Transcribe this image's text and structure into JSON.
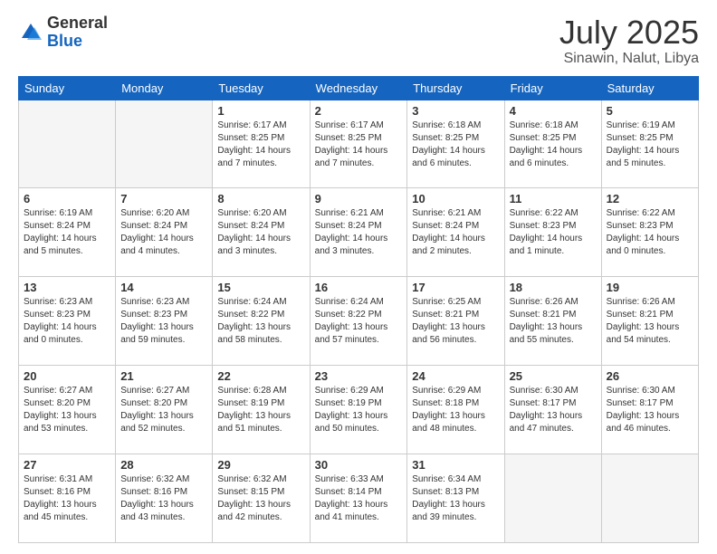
{
  "header": {
    "logo_general": "General",
    "logo_blue": "Blue",
    "month": "July 2025",
    "location": "Sinawin, Nalut, Libya"
  },
  "days_of_week": [
    "Sunday",
    "Monday",
    "Tuesday",
    "Wednesday",
    "Thursday",
    "Friday",
    "Saturday"
  ],
  "weeks": [
    [
      {
        "day": "",
        "info": ""
      },
      {
        "day": "",
        "info": ""
      },
      {
        "day": "1",
        "info": "Sunrise: 6:17 AM\nSunset: 8:25 PM\nDaylight: 14 hours and 7 minutes."
      },
      {
        "day": "2",
        "info": "Sunrise: 6:17 AM\nSunset: 8:25 PM\nDaylight: 14 hours and 7 minutes."
      },
      {
        "day": "3",
        "info": "Sunrise: 6:18 AM\nSunset: 8:25 PM\nDaylight: 14 hours and 6 minutes."
      },
      {
        "day": "4",
        "info": "Sunrise: 6:18 AM\nSunset: 8:25 PM\nDaylight: 14 hours and 6 minutes."
      },
      {
        "day": "5",
        "info": "Sunrise: 6:19 AM\nSunset: 8:25 PM\nDaylight: 14 hours and 5 minutes."
      }
    ],
    [
      {
        "day": "6",
        "info": "Sunrise: 6:19 AM\nSunset: 8:24 PM\nDaylight: 14 hours and 5 minutes."
      },
      {
        "day": "7",
        "info": "Sunrise: 6:20 AM\nSunset: 8:24 PM\nDaylight: 14 hours and 4 minutes."
      },
      {
        "day": "8",
        "info": "Sunrise: 6:20 AM\nSunset: 8:24 PM\nDaylight: 14 hours and 3 minutes."
      },
      {
        "day": "9",
        "info": "Sunrise: 6:21 AM\nSunset: 8:24 PM\nDaylight: 14 hours and 3 minutes."
      },
      {
        "day": "10",
        "info": "Sunrise: 6:21 AM\nSunset: 8:24 PM\nDaylight: 14 hours and 2 minutes."
      },
      {
        "day": "11",
        "info": "Sunrise: 6:22 AM\nSunset: 8:23 PM\nDaylight: 14 hours and 1 minute."
      },
      {
        "day": "12",
        "info": "Sunrise: 6:22 AM\nSunset: 8:23 PM\nDaylight: 14 hours and 0 minutes."
      }
    ],
    [
      {
        "day": "13",
        "info": "Sunrise: 6:23 AM\nSunset: 8:23 PM\nDaylight: 14 hours and 0 minutes."
      },
      {
        "day": "14",
        "info": "Sunrise: 6:23 AM\nSunset: 8:23 PM\nDaylight: 13 hours and 59 minutes."
      },
      {
        "day": "15",
        "info": "Sunrise: 6:24 AM\nSunset: 8:22 PM\nDaylight: 13 hours and 58 minutes."
      },
      {
        "day": "16",
        "info": "Sunrise: 6:24 AM\nSunset: 8:22 PM\nDaylight: 13 hours and 57 minutes."
      },
      {
        "day": "17",
        "info": "Sunrise: 6:25 AM\nSunset: 8:21 PM\nDaylight: 13 hours and 56 minutes."
      },
      {
        "day": "18",
        "info": "Sunrise: 6:26 AM\nSunset: 8:21 PM\nDaylight: 13 hours and 55 minutes."
      },
      {
        "day": "19",
        "info": "Sunrise: 6:26 AM\nSunset: 8:21 PM\nDaylight: 13 hours and 54 minutes."
      }
    ],
    [
      {
        "day": "20",
        "info": "Sunrise: 6:27 AM\nSunset: 8:20 PM\nDaylight: 13 hours and 53 minutes."
      },
      {
        "day": "21",
        "info": "Sunrise: 6:27 AM\nSunset: 8:20 PM\nDaylight: 13 hours and 52 minutes."
      },
      {
        "day": "22",
        "info": "Sunrise: 6:28 AM\nSunset: 8:19 PM\nDaylight: 13 hours and 51 minutes."
      },
      {
        "day": "23",
        "info": "Sunrise: 6:29 AM\nSunset: 8:19 PM\nDaylight: 13 hours and 50 minutes."
      },
      {
        "day": "24",
        "info": "Sunrise: 6:29 AM\nSunset: 8:18 PM\nDaylight: 13 hours and 48 minutes."
      },
      {
        "day": "25",
        "info": "Sunrise: 6:30 AM\nSunset: 8:17 PM\nDaylight: 13 hours and 47 minutes."
      },
      {
        "day": "26",
        "info": "Sunrise: 6:30 AM\nSunset: 8:17 PM\nDaylight: 13 hours and 46 minutes."
      }
    ],
    [
      {
        "day": "27",
        "info": "Sunrise: 6:31 AM\nSunset: 8:16 PM\nDaylight: 13 hours and 45 minutes."
      },
      {
        "day": "28",
        "info": "Sunrise: 6:32 AM\nSunset: 8:16 PM\nDaylight: 13 hours and 43 minutes."
      },
      {
        "day": "29",
        "info": "Sunrise: 6:32 AM\nSunset: 8:15 PM\nDaylight: 13 hours and 42 minutes."
      },
      {
        "day": "30",
        "info": "Sunrise: 6:33 AM\nSunset: 8:14 PM\nDaylight: 13 hours and 41 minutes."
      },
      {
        "day": "31",
        "info": "Sunrise: 6:34 AM\nSunset: 8:13 PM\nDaylight: 13 hours and 39 minutes."
      },
      {
        "day": "",
        "info": ""
      },
      {
        "day": "",
        "info": ""
      }
    ]
  ]
}
